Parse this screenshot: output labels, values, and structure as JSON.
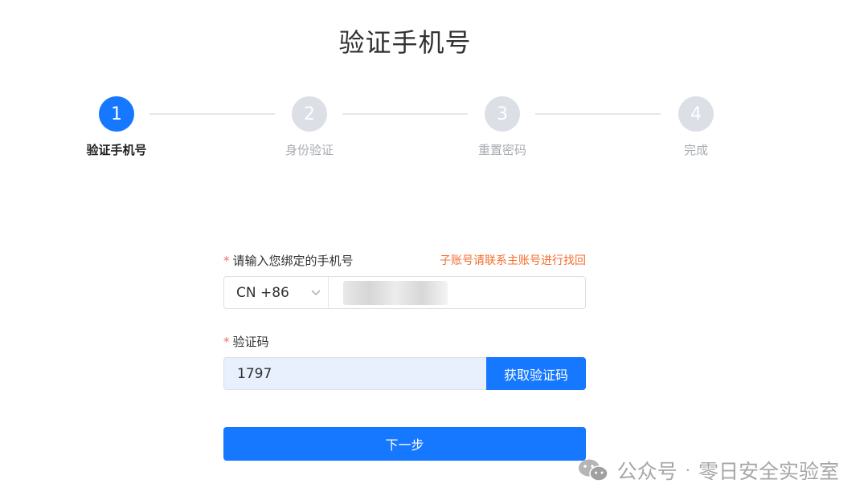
{
  "title": "验证手机号",
  "steps": [
    {
      "num": "1",
      "label": "验证手机号"
    },
    {
      "num": "2",
      "label": "身份验证"
    },
    {
      "num": "3",
      "label": "重置密码"
    },
    {
      "num": "4",
      "label": "完成"
    }
  ],
  "form": {
    "phone_label": "请输入您绑定的手机号",
    "required_mark": "*",
    "recover_link": "子账号请联系主账号进行找回",
    "country_code": "CN +86",
    "code_label": "验证码",
    "code_value": "1797",
    "get_code_button": "获取验证码",
    "next_button": "下一步"
  },
  "watermark": {
    "source": "公众号",
    "separator": "·",
    "name": "零日安全实验室"
  },
  "colors": {
    "primary": "#1677ff",
    "inactive_step": "#dcdfe6",
    "required": "#f56c6c",
    "link": "#f56c2c"
  }
}
